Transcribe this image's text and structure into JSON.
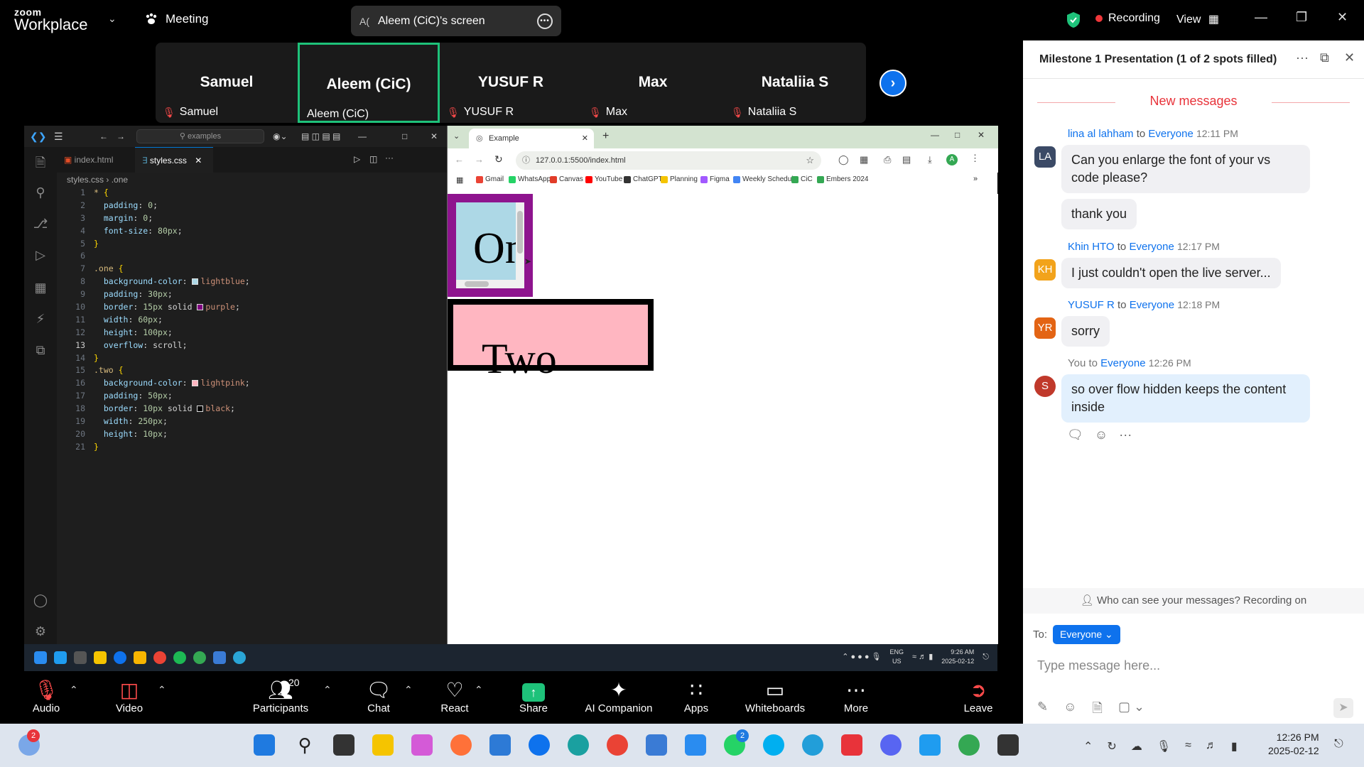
{
  "app": {
    "brand_line1": "zoom",
    "brand_line2": "Workplace",
    "meeting_label": "Meeting",
    "share_label": "Aleem (CiC)'s screen",
    "share_avatar": "A(",
    "recording_label": "Recording",
    "view_label": "View"
  },
  "participants_strip": [
    {
      "name": "Samuel",
      "label": "Samuel",
      "muted": true,
      "active": false
    },
    {
      "name": "Aleem (CiC)",
      "label": "Aleem (CiC)",
      "muted": false,
      "active": true
    },
    {
      "name": "YUSUF R",
      "label": "YUSUF R",
      "muted": true,
      "active": false
    },
    {
      "name": "Max",
      "label": "Max",
      "muted": true,
      "active": false
    },
    {
      "name": "Nataliia S",
      "label": "Nataliia S",
      "muted": true,
      "active": false
    }
  ],
  "vscode": {
    "search_placeholder": "examples",
    "tabs": [
      {
        "label": "index.html",
        "active": false
      },
      {
        "label": "styles.css",
        "active": true
      }
    ],
    "breadcrumb_file": "styles.css",
    "breadcrumb_symbol": ".one",
    "lines": [
      {
        "n": "1",
        "tokens": [
          [
            "sel",
            "* "
          ],
          [
            "brace",
            "{"
          ]
        ]
      },
      {
        "n": "2",
        "tokens": [
          [
            "prop",
            "  padding"
          ],
          [
            "pun",
            ": "
          ],
          [
            "num",
            "0"
          ],
          [
            "pun",
            ";"
          ]
        ]
      },
      {
        "n": "3",
        "tokens": [
          [
            "prop",
            "  margin"
          ],
          [
            "pun",
            ": "
          ],
          [
            "num",
            "0"
          ],
          [
            "pun",
            ";"
          ]
        ]
      },
      {
        "n": "4",
        "tokens": [
          [
            "prop",
            "  font-size"
          ],
          [
            "pun",
            ": "
          ],
          [
            "num",
            "80px"
          ],
          [
            "pun",
            ";"
          ]
        ]
      },
      {
        "n": "5",
        "tokens": [
          [
            "brace",
            "}"
          ]
        ]
      },
      {
        "n": "6",
        "tokens": []
      },
      {
        "n": "7",
        "tokens": [
          [
            "sel",
            ".one "
          ],
          [
            "brace",
            "{"
          ]
        ]
      },
      {
        "n": "8",
        "tokens": [
          [
            "prop",
            "  background-color"
          ],
          [
            "pun",
            ": "
          ],
          [
            "sw",
            "#add8e6"
          ],
          [
            "val",
            "lightblue"
          ],
          [
            "pun",
            ";"
          ]
        ]
      },
      {
        "n": "9",
        "tokens": [
          [
            "prop",
            "  padding"
          ],
          [
            "pun",
            ": "
          ],
          [
            "num",
            "30px"
          ],
          [
            "pun",
            ";"
          ]
        ]
      },
      {
        "n": "10",
        "tokens": [
          [
            "prop",
            "  border"
          ],
          [
            "pun",
            ": "
          ],
          [
            "num",
            "15px"
          ],
          [
            "pun",
            " solid "
          ],
          [
            "sw",
            "#800080"
          ],
          [
            "val",
            "purple"
          ],
          [
            "pun",
            ";"
          ]
        ]
      },
      {
        "n": "11",
        "tokens": [
          [
            "prop",
            "  width"
          ],
          [
            "pun",
            ": "
          ],
          [
            "num",
            "60px"
          ],
          [
            "pun",
            ";"
          ]
        ]
      },
      {
        "n": "12",
        "tokens": [
          [
            "prop",
            "  height"
          ],
          [
            "pun",
            ": "
          ],
          [
            "num",
            "100px"
          ],
          [
            "pun",
            ";"
          ]
        ]
      },
      {
        "n": "13",
        "tokens": [
          [
            "prop",
            "  overflow"
          ],
          [
            "pun",
            ": scroll;"
          ]
        ]
      },
      {
        "n": "14",
        "tokens": [
          [
            "brace",
            "}"
          ]
        ]
      },
      {
        "n": "15",
        "tokens": [
          [
            "sel",
            ".two "
          ],
          [
            "brace",
            "{"
          ]
        ]
      },
      {
        "n": "16",
        "tokens": [
          [
            "prop",
            "  background-color"
          ],
          [
            "pun",
            ": "
          ],
          [
            "sw",
            "#ffb6c1"
          ],
          [
            "val",
            "lightpink"
          ],
          [
            "pun",
            ";"
          ]
        ]
      },
      {
        "n": "17",
        "tokens": [
          [
            "prop",
            "  padding"
          ],
          [
            "pun",
            ": "
          ],
          [
            "num",
            "50px"
          ],
          [
            "pun",
            ";"
          ]
        ]
      },
      {
        "n": "18",
        "tokens": [
          [
            "prop",
            "  border"
          ],
          [
            "pun",
            ": "
          ],
          [
            "num",
            "10px"
          ],
          [
            "pun",
            " solid "
          ],
          [
            "sw",
            "#000000"
          ],
          [
            "val",
            "black"
          ],
          [
            "pun",
            ";"
          ]
        ]
      },
      {
        "n": "19",
        "tokens": [
          [
            "prop",
            "  width"
          ],
          [
            "pun",
            ": "
          ],
          [
            "num",
            "250px"
          ],
          [
            "pun",
            ";"
          ]
        ]
      },
      {
        "n": "20",
        "tokens": [
          [
            "prop",
            "  height"
          ],
          [
            "pun",
            ": "
          ],
          [
            "num",
            "10px"
          ],
          [
            "pun",
            ";"
          ]
        ]
      },
      {
        "n": "21",
        "tokens": [
          [
            "brace",
            "}"
          ]
        ]
      }
    ],
    "current_line": "13"
  },
  "browser": {
    "tab_title": "Example",
    "url": "127.0.0.1:5500/index.html",
    "bookmarks": [
      {
        "label": "Gmail",
        "color": "#ea4335"
      },
      {
        "label": "WhatsApp",
        "color": "#25d366"
      },
      {
        "label": "Canvas",
        "color": "#e13c28"
      },
      {
        "label": "YouTube",
        "color": "#ff0000"
      },
      {
        "label": "ChatGPT",
        "color": "#333333"
      },
      {
        "label": "Planning",
        "color": "#f5c400"
      },
      {
        "label": "Figma",
        "color": "#a259ff"
      },
      {
        "label": "Weekly Schedule",
        "color": "#4285f4"
      },
      {
        "label": "CiC",
        "color": "#34a853"
      },
      {
        "label": "Embers 2024",
        "color": "#34a853"
      }
    ],
    "box_one_text": "One",
    "box_two_text": "Two"
  },
  "inner_taskbar": {
    "lang_line1": "ENG",
    "lang_line2": "US",
    "time": "9:26 AM",
    "date": "2025-02-12"
  },
  "chat": {
    "title": "Milestone 1 Presentation (1 of 2 spots filled)",
    "new_messages": "New messages",
    "messages": [
      {
        "sender": "lina al lahham",
        "to_word": "to",
        "recipient": "Everyone",
        "time": "12:11 PM",
        "initials": "LA",
        "avatar_color": "#3b4a66",
        "texts": [
          "Can you enlarge the font of your vs code please?",
          "thank you"
        ]
      },
      {
        "sender": "Khin HTO",
        "to_word": "to",
        "recipient": "Everyone",
        "time": "12:17 PM",
        "initials": "KH",
        "avatar_color": "#f2a31b",
        "texts": [
          "I just couldn't open the live server..."
        ]
      },
      {
        "sender": "YUSUF R",
        "to_word": "to",
        "recipient": "Everyone",
        "time": "12:18 PM",
        "initials": "YR",
        "avatar_color": "#e36414",
        "texts": [
          "sorry"
        ]
      },
      {
        "sender": "You",
        "to_word": "to",
        "recipient": "Everyone",
        "time": "12:26 PM",
        "initials": "S",
        "avatar_color": "#c0392b",
        "texts": [
          "so over flow hidden keeps the content inside"
        ]
      }
    ],
    "visibility_note": "Who can see your messages? Recording on",
    "to_label": "To:",
    "to_value": "Everyone",
    "input_placeholder": "Type message here..."
  },
  "toolbar": {
    "audio": "Audio",
    "video": "Video",
    "participants": "Participants",
    "participants_count": "20",
    "chat": "Chat",
    "react": "React",
    "share": "Share",
    "ai_companion": "AI Companion",
    "apps": "Apps",
    "whiteboards": "Whiteboards",
    "more": "More",
    "leave": "Leave"
  },
  "os_taskbar": {
    "weather_badge": "2",
    "whatsapp_badge": "2",
    "time": "12:26 PM",
    "date": "2025-02-12"
  }
}
